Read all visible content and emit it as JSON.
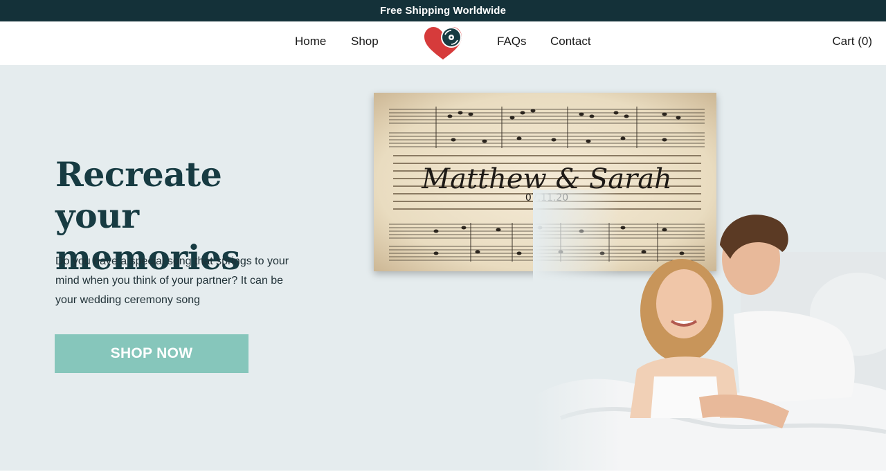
{
  "announcement": {
    "text": "Free Shipping Worldwide"
  },
  "nav": {
    "home": "Home",
    "shop": "Shop",
    "faqs": "FAQs",
    "contact": "Contact",
    "cart": "Cart (0)"
  },
  "logo": {
    "icon": "heart-vinyl-logo-icon"
  },
  "hero": {
    "headline_line1": "Recreate",
    "headline_line2": "your memories",
    "subtext": "Do you have a special song that springs to your mind when you think of your partner? It can be your wedding ceremony song",
    "cta": "SHOP NOW",
    "print": {
      "names": "Matthew & Sarah",
      "date": "07.11.20"
    }
  },
  "colors": {
    "topbar_bg": "#143139",
    "hero_bg": "#e5ecee",
    "headline": "#173b42",
    "button": "#86c6bb",
    "logo_heart": "#d63b3b"
  }
}
